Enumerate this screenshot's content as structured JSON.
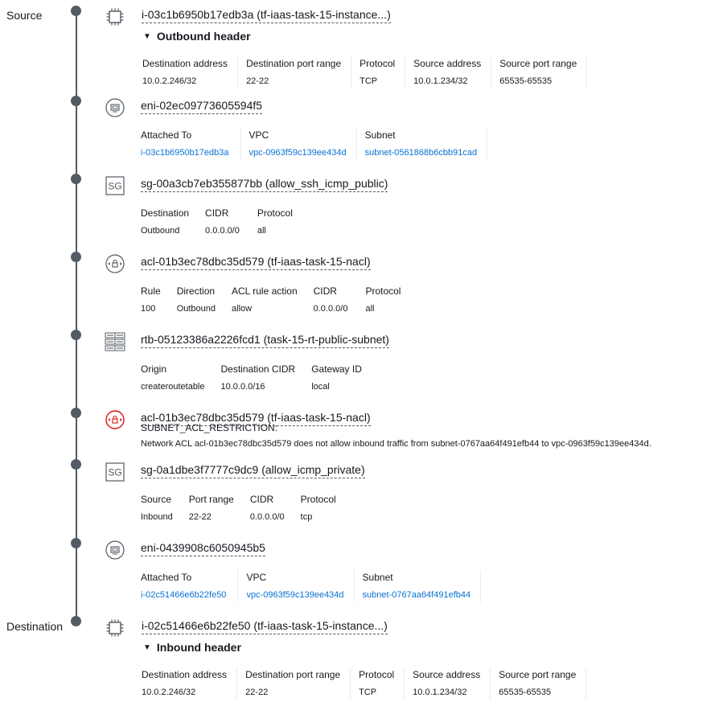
{
  "side": {
    "source": "Source",
    "destination": "Destination"
  },
  "steps": {
    "src_instance": {
      "icon": "ec2-instance-icon",
      "resource": "i-03c1b6950b17edb3a (tf-iaas-task-15-instance...)",
      "header": "Outbound header",
      "cols": [
        {
          "k": "Destination address",
          "v": "10.0.2.246/32"
        },
        {
          "k": "Destination port range",
          "v": "22-22"
        },
        {
          "k": "Protocol",
          "v": "TCP"
        },
        {
          "k": "Source address",
          "v": "10.0.1.234/32"
        },
        {
          "k": "Source port range",
          "v": "65535-65535"
        }
      ]
    },
    "eni1": {
      "icon": "network-interface-icon",
      "resource": "eni-02ec09773605594f5",
      "cols": [
        {
          "k": "Attached To",
          "v": "i-03c1b6950b17edb3a"
        },
        {
          "k": "VPC",
          "v": "vpc-0963f59c139ee434d"
        },
        {
          "k": "Subnet",
          "v": "subnet-0561868b6cbb91cad"
        }
      ]
    },
    "sg1": {
      "icon": "security-group-icon",
      "icon_text": "SG",
      "resource": "sg-00a3cb7eb355877bb (allow_ssh_icmp_public)",
      "cols": [
        {
          "k": "Destination",
          "v": "Outbound"
        },
        {
          "k": "CIDR",
          "v": "0.0.0.0/0"
        },
        {
          "k": "Protocol",
          "v": "all"
        }
      ]
    },
    "acl1": {
      "icon": "network-acl-icon",
      "resource": "acl-01b3ec78dbc35d579 (tf-iaas-task-15-nacl)",
      "cols": [
        {
          "k": "Rule",
          "v": "100"
        },
        {
          "k": "Direction",
          "v": "Outbound"
        },
        {
          "k": "ACL rule action",
          "v": "allow"
        },
        {
          "k": "CIDR",
          "v": "0.0.0.0/0"
        },
        {
          "k": "Protocol",
          "v": "all"
        }
      ]
    },
    "rtb": {
      "icon": "route-table-icon",
      "resource": "rtb-05123386a2226fcd1 (task-15-rt-public-subnet)",
      "cols": [
        {
          "k": "Origin",
          "v": "createroutetable"
        },
        {
          "k": "Destination CIDR",
          "v": "10.0.0.0/16"
        },
        {
          "k": "Gateway ID",
          "v": "local"
        }
      ]
    },
    "acl_blocked": {
      "icon": "network-acl-blocked-icon",
      "resource": "acl-01b3ec78dbc35d579 (tf-iaas-task-15-nacl)",
      "restriction_title": "SUBNET_ACL_RESTRICTION:",
      "restriction_msg": "Network ACL acl-01b3ec78dbc35d579 does not allow inbound traffic from subnet-0767aa64f491efb44 to vpc-0963f59c139ee434d."
    },
    "sg2": {
      "icon": "security-group-icon",
      "icon_text": "SG",
      "resource": "sg-0a1dbe3f7777c9dc9 (allow_icmp_private)",
      "cols": [
        {
          "k": "Source",
          "v": "Inbound"
        },
        {
          "k": "Port range",
          "v": "22-22"
        },
        {
          "k": "CIDR",
          "v": "0.0.0.0/0"
        },
        {
          "k": "Protocol",
          "v": "tcp"
        }
      ]
    },
    "eni2": {
      "icon": "network-interface-icon",
      "resource": "eni-0439908c6050945b5",
      "cols": [
        {
          "k": "Attached To",
          "v": "i-02c51466e6b22fe50"
        },
        {
          "k": "VPC",
          "v": "vpc-0963f59c139ee434d"
        },
        {
          "k": "Subnet",
          "v": "subnet-0767aa64f491efb44"
        }
      ]
    },
    "dst_instance": {
      "icon": "ec2-instance-icon",
      "resource": "i-02c51466e6b22fe50 (tf-iaas-task-15-instance...)",
      "header": "Inbound header",
      "cols": [
        {
          "k": "Destination address",
          "v": "10.0.2.246/32"
        },
        {
          "k": "Destination port range",
          "v": "22-22"
        },
        {
          "k": "Protocol",
          "v": "TCP"
        },
        {
          "k": "Source address",
          "v": "10.0.1.234/32"
        },
        {
          "k": "Source port range",
          "v": "65535-65535"
        }
      ]
    }
  },
  "colors": {
    "line": "#545b64",
    "link": "#0972d3",
    "error": "#d91515"
  }
}
